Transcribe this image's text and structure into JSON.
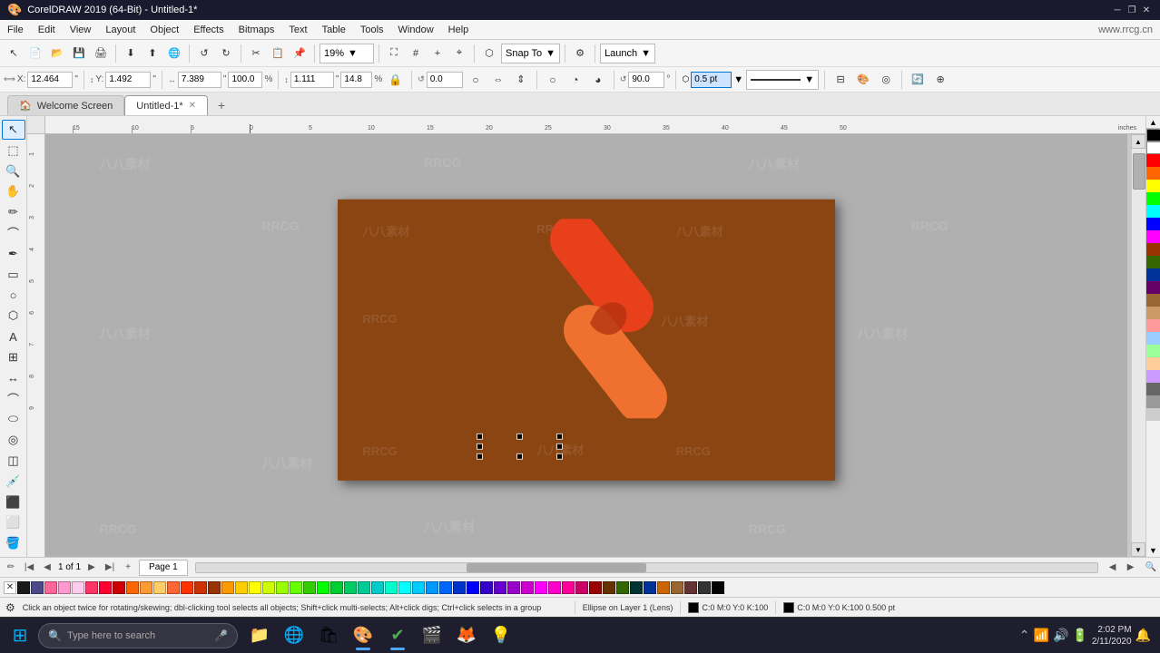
{
  "titlebar": {
    "title": "CorelDRAW 2019 (64-Bit) - Untitled-1*",
    "watermark_url": "www.rrcg.cn",
    "min_btn": "─",
    "max_btn": "□",
    "close_btn": "✕",
    "restore_btn": "❐"
  },
  "menubar": {
    "items": [
      "File",
      "Edit",
      "View",
      "Layout",
      "Object",
      "Effects",
      "Bitmaps",
      "Text",
      "Table",
      "Tools",
      "Window",
      "Help"
    ]
  },
  "toolbar1": {
    "snap_to_label": "Snap To",
    "launch_label": "Launch",
    "zoom_value": "19%"
  },
  "toolbar2": {
    "x_label": "X:",
    "x_value": "12.464",
    "y_label": "Y:",
    "y_value": "1.492",
    "w_label": "W:",
    "w_value": "7.389",
    "h_label": "H:",
    "h_value": "1.111",
    "w_pct": "100.0",
    "h_pct": "14.8",
    "angle_value": "0.0",
    "angle2_value": "90.0",
    "stroke_value": "0.5 pt",
    "unit": "\""
  },
  "tabs": {
    "welcome_label": "Welcome Screen",
    "doc_label": "Untitled-1*",
    "add_tab": "+"
  },
  "canvas": {
    "document_bg": "#8B4A2A",
    "watermarks": [
      "八八素材",
      "RRCG",
      "八八素材",
      "RRCG",
      "八八素材",
      "RRCG"
    ],
    "logo_color_top": "#E8401A",
    "logo_color_bottom": "#F07030",
    "logo_color_overlap": "#CC3010"
  },
  "bottom_bar": {
    "page_label": "Page 1",
    "add_page_icon": "+"
  },
  "statusbar": {
    "message": "Click an object twice for rotating/skewing; dbl-clicking tool selects all objects; Shift+click multi-selects; Alt+click digs; Ctrl+click selects in a group",
    "object_info": "Ellipse on Layer 1  (Lens)",
    "fill_label": "C:0 M:0 Y:0 K:100",
    "stroke_label": "C:0 M:0 Y:0 K:100  0.500 pt"
  },
  "color_bar": {
    "special": [
      "✕",
      "□"
    ],
    "colors": [
      "#FF0000",
      "#FF3300",
      "#FF6600",
      "#FF9900",
      "#FFCC00",
      "#FFFF00",
      "#CCFF00",
      "#99FF00",
      "#66FF00",
      "#33FF00",
      "#00FF00",
      "#00FF33",
      "#00FF66",
      "#00FF99",
      "#00FFCC",
      "#00FFFF",
      "#00CCFF",
      "#0099FF",
      "#0066FF",
      "#0033FF",
      "#0000FF",
      "#3300FF",
      "#6600FF",
      "#9900FF",
      "#CC00FF",
      "#FF00FF",
      "#FF00CC",
      "#FF0099",
      "#FF0066",
      "#FF0033",
      "#CC0000",
      "#993300",
      "#666600",
      "#336633",
      "#003366",
      "#CC6600",
      "#996633",
      "#663333",
      "#333333",
      "#000000",
      "#FFFFFF",
      "#FFCCCC",
      "#FFCC99",
      "#FFFF99",
      "#CCFFCC",
      "#CCFFFF",
      "#CCE5FF",
      "#E5CCFF",
      "#FFE5CC",
      "#E8E8E8"
    ]
  },
  "taskbar": {
    "search_placeholder": "Type here to search",
    "apps": [
      {
        "name": "file-explorer",
        "icon": "📁"
      },
      {
        "name": "edge-browser",
        "icon": "🌐"
      },
      {
        "name": "windows-store",
        "icon": "🛍"
      },
      {
        "name": "corel-draw",
        "icon": "🎨"
      },
      {
        "name": "app5",
        "icon": "✔"
      },
      {
        "name": "app6",
        "icon": "🎬"
      },
      {
        "name": "app7",
        "icon": "🦊"
      },
      {
        "name": "app8",
        "icon": "💡"
      }
    ],
    "time": "2:02 PM",
    "date": "2/11/2020"
  }
}
